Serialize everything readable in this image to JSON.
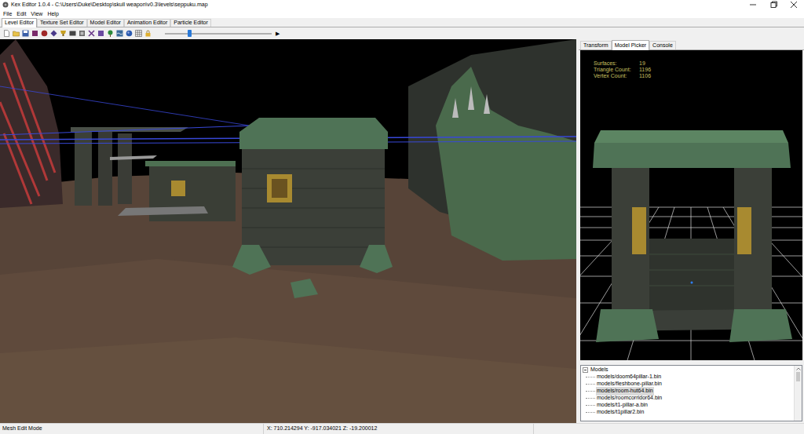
{
  "window": {
    "title": "Kex Editor 1.0.4 - C:\\Users\\Duke\\Desktop\\skull weapon\\v0.3\\levels\\seppuku.map"
  },
  "menu": [
    "File",
    "Edit",
    "View",
    "Help"
  ],
  "tabs": [
    {
      "label": "Level Editor",
      "selected": true
    },
    {
      "label": "Texture Set Editor",
      "selected": false
    },
    {
      "label": "Model Editor",
      "selected": false
    },
    {
      "label": "Animation Editor",
      "selected": false
    },
    {
      "label": "Particle Editor",
      "selected": false
    }
  ],
  "toolbar": {
    "slider": {
      "level": 0.23
    },
    "play": "▶"
  },
  "side_tabs": [
    {
      "label": "Transform",
      "selected": false
    },
    {
      "label": "Model Picker",
      "selected": true
    },
    {
      "label": "Console",
      "selected": false
    }
  ],
  "stats": [
    {
      "label": "Surfaces:",
      "value": "19"
    },
    {
      "label": "Triangle Count:",
      "value": "1196"
    },
    {
      "label": "Vertex Count:",
      "value": "1106"
    }
  ],
  "tree": {
    "root": "Models",
    "expanded": true,
    "items": [
      {
        "label": "models/doom64pillar-1.bin",
        "selected": false
      },
      {
        "label": "models/fleshbone-pillar.bin",
        "selected": false
      },
      {
        "label": "models/room-hut64.bin",
        "selected": true
      },
      {
        "label": "models/roomcorridor64.bin",
        "selected": false
      },
      {
        "label": "models/t1-pillar-a.bin",
        "selected": false
      },
      {
        "label": "models/t1pillar2.bin",
        "selected": false
      }
    ]
  },
  "status_bar": {
    "mode": "Mesh Edit Mode",
    "coords": "X: 710.214294 Y: -917.034021 Z: -19.200012"
  }
}
